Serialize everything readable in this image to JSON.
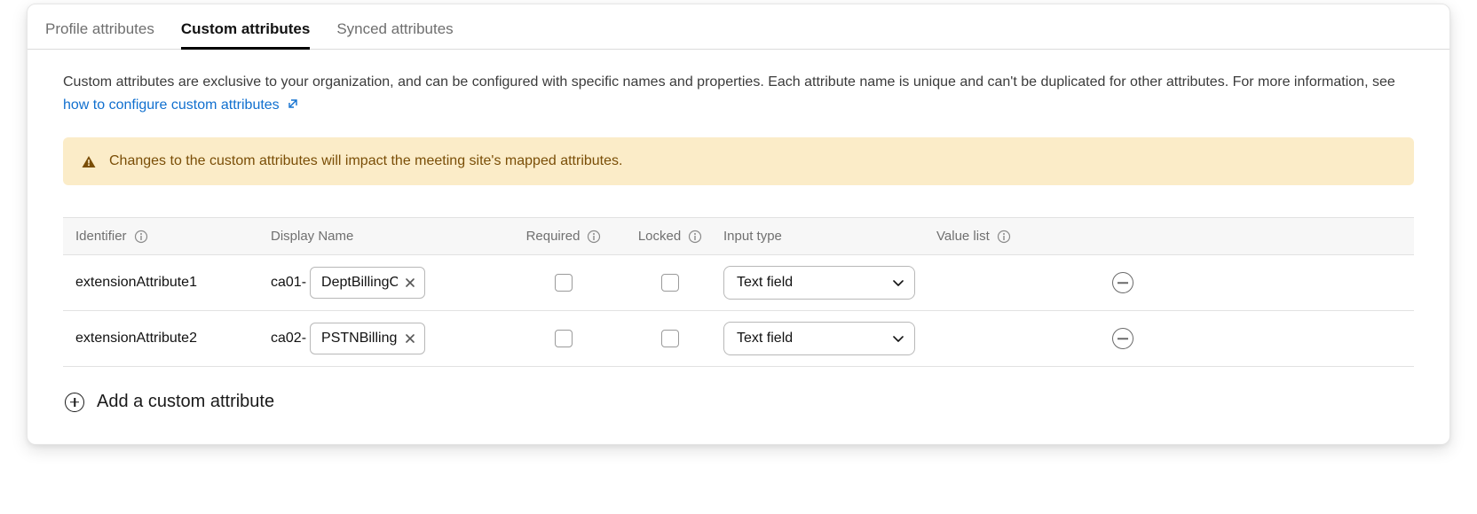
{
  "tabs": [
    {
      "label": "Profile attributes",
      "active": false
    },
    {
      "label": "Custom attributes",
      "active": true
    },
    {
      "label": "Synced attributes",
      "active": false
    }
  ],
  "intro": {
    "text": "Custom attributes are exclusive to your organization, and can be configured with specific names and properties. Each attribute name is unique and can't be duplicated for other attributes. For more information, see ",
    "link_text": "how to configure custom attributes"
  },
  "alert": {
    "text": "Changes to the custom attributes will impact the meeting site's mapped attributes."
  },
  "columns": {
    "identifier": "Identifier",
    "display_name": "Display Name",
    "required": "Required",
    "locked": "Locked",
    "input_type": "Input type",
    "value_list": "Value list"
  },
  "rows": [
    {
      "identifier": "extensionAttribute1",
      "prefix": "ca01-",
      "name_value": "DeptBillingCode",
      "required": false,
      "locked": false,
      "input_type": "Text field"
    },
    {
      "identifier": "extensionAttribute2",
      "prefix": "ca02-",
      "name_value": "PSTNBillingCode",
      "required": false,
      "locked": false,
      "input_type": "Text field"
    }
  ],
  "add_label": "Add a custom attribute"
}
